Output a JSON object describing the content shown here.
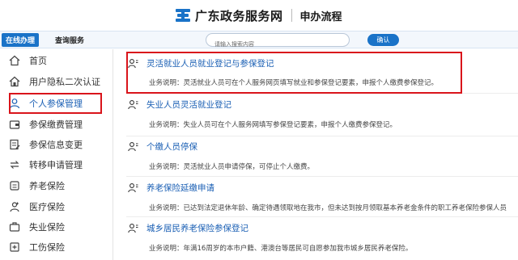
{
  "header": {
    "logo_icon": "guangdong-gov-logo-icon",
    "site_name": "广东政务服务网",
    "section_name": "申办流程",
    "brand_color": "#1a73c8"
  },
  "navbar": {
    "tab_active_label": "在线办理",
    "tab_query_label": "查询服务",
    "search_placeholder": "请输入搜索内容",
    "search_value": "",
    "confirm_label": "确认"
  },
  "sidebar": {
    "items": [
      {
        "label": "首页",
        "icon": "home-icon"
      },
      {
        "label": "用户隐私二次认证",
        "icon": "house-lock-icon"
      },
      {
        "label": "个人参保管理",
        "icon": "person-icon",
        "active": true
      },
      {
        "label": "参保缴费管理",
        "icon": "wallet-icon"
      },
      {
        "label": "参保信息变更",
        "icon": "document-edit-icon"
      },
      {
        "label": "转移申请管理",
        "icon": "transfer-icon"
      },
      {
        "label": "养老保险",
        "icon": "pension-icon"
      },
      {
        "label": "医疗保险",
        "icon": "medical-icon"
      },
      {
        "label": "失业保险",
        "icon": "unemployment-icon"
      },
      {
        "label": "工伤保险",
        "icon": "injury-icon"
      }
    ]
  },
  "entries": [
    {
      "title": "灵活就业人员就业登记与参保登记",
      "desc": "业务说明：灵活就业人员可在个人服务网页填写就业和参保登记要素，申报个人缴费参保登记。",
      "icon": "person-card-icon",
      "highlighted": true
    },
    {
      "title": "失业人员灵活就业登记",
      "desc": "业务说明：失业人员可在个人服务网填写参保登记要素，申报个人缴费参保登记。",
      "icon": "person-card-icon"
    },
    {
      "title": "个缴人员停保",
      "desc": "业务说明：灵活就业人员申请停保，可停止个人缴费。",
      "icon": "person-card-icon"
    },
    {
      "title": "养老保险延缴申请",
      "desc": "业务说明：已达到法定退休年龄、确定待遇领取地在我市，但未达到按月领取基本养老金条件的职工养老保险参保人员",
      "icon": "person-card-icon"
    },
    {
      "title": "城乡居民养老保险参保登记",
      "desc": "业务说明：年满16周岁的本市户籍、港澳台等居民可自愿参加我市城乡居民养老保险。",
      "icon": "person-card-icon"
    }
  ],
  "colors": {
    "highlight_border": "#d9141b",
    "link_blue": "#1a5fb4"
  }
}
